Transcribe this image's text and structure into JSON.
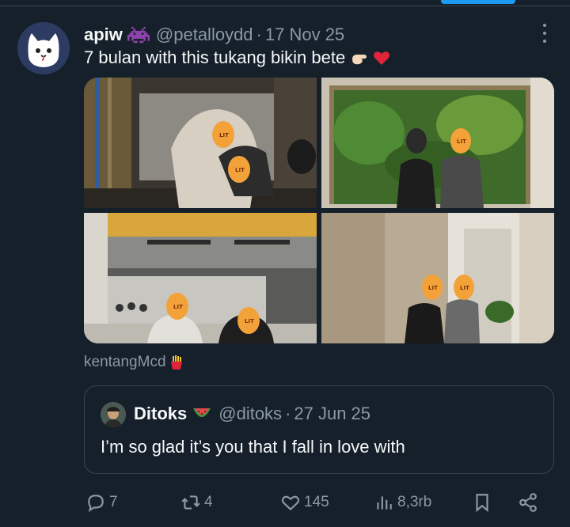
{
  "tweet": {
    "display_name": "apiw",
    "handle": "@petalloydd",
    "separator": "·",
    "date": "17 Nov 25",
    "text": "7 bulan with this tukang bikin bete",
    "caption": "kentangMcd",
    "photo_sticker_label": "LIT"
  },
  "quote": {
    "display_name": "Ditoks",
    "handle": "@ditoks",
    "separator": "·",
    "date": "27 Jun 25",
    "text": "I’m so glad it’s you that I fall in love with"
  },
  "actions": {
    "replies": "7",
    "reposts": "4",
    "likes": "145",
    "views": "8,3rb"
  },
  "icons": {
    "avatar": "white-cat-avatar-icon",
    "name_emoji": "space-invader-icon",
    "text_emojis": [
      "pinching-hand-emoji",
      "red-heart-emoji"
    ],
    "caption_emoji": "fries-emoji",
    "quote_name_emoji": "watermelon-emoji",
    "reply": "reply-icon",
    "repost": "repost-icon",
    "like": "heart-icon",
    "views": "views-chart-icon",
    "bookmark": "bookmark-icon",
    "share": "share-icon",
    "more": "more-dots-icon"
  },
  "colors": {
    "background": "#15202b",
    "text": "#f7f9f9",
    "secondary": "#8b98a5",
    "border": "#38444d",
    "accent": "#1d9bf0"
  }
}
